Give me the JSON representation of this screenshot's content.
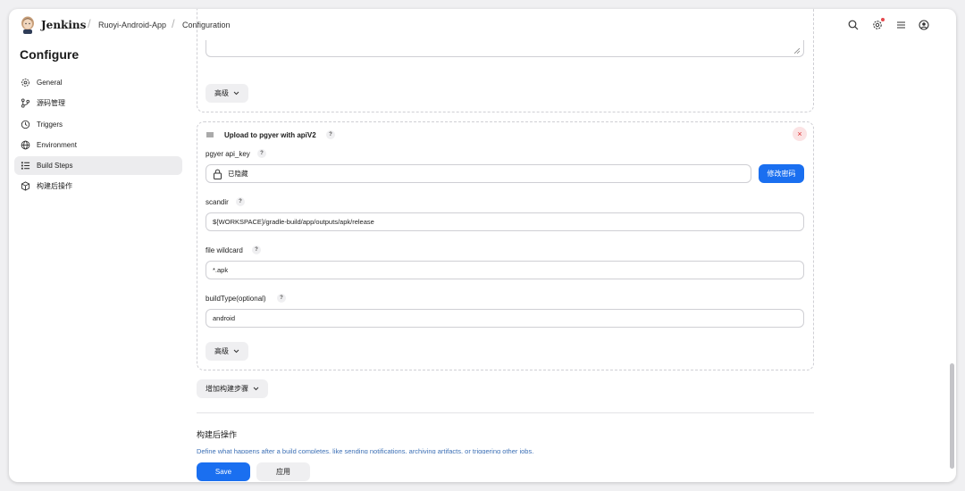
{
  "header": {
    "brand": "Jenkins",
    "breadcrumbs": [
      "Ruoyi-Android-App",
      "Configuration"
    ],
    "icons": [
      "search-icon",
      "settings-icon",
      "menu-icon",
      "user-icon"
    ]
  },
  "sidebar": {
    "title": "Configure",
    "items": [
      {
        "label": "General",
        "icon": "gear-icon"
      },
      {
        "label": "源码管理",
        "icon": "branch-icon"
      },
      {
        "label": "Triggers",
        "icon": "clock-icon"
      },
      {
        "label": "Environment",
        "icon": "globe-icon"
      },
      {
        "label": "Build Steps",
        "icon": "list-icon",
        "active": true
      },
      {
        "label": "构建后操作",
        "icon": "package-icon"
      }
    ]
  },
  "main": {
    "advanced_label": "高级",
    "step": {
      "title": "Upload to pgyer with apiV2",
      "fields": [
        {
          "label": "pgyer api_key",
          "value": "已隐藏",
          "button": "修改密码"
        },
        {
          "label": "scandir",
          "value": "${WORKSPACE}/gradle-build/app/outputs/apk/release"
        },
        {
          "label": "file wildcard",
          "value": "*.apk"
        },
        {
          "label": "buildType(optional)",
          "value": "android"
        }
      ]
    },
    "add_step_label": "增加构建步骤",
    "post_build": {
      "title": "构建后操作",
      "description": "Define what happens after a build completes, like sending notifications, archiving artifacts, or triggering other jobs."
    },
    "help_label": "?",
    "close_label": "×"
  },
  "footer": {
    "save_label": "Save",
    "apply_label": "应用"
  },
  "colors": {
    "primary": "#1a6ff0",
    "active_bg": "#ececee",
    "danger": "#d33"
  }
}
